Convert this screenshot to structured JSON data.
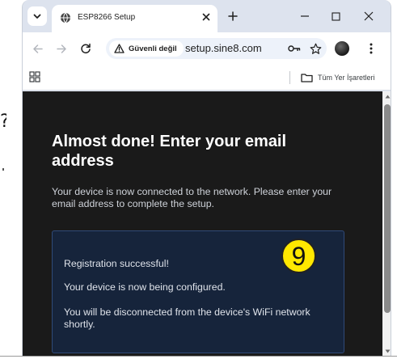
{
  "browser": {
    "tab_title": "ESP8266 Setup",
    "security_label": "Güvenli değil",
    "url": "setup.sine8.com",
    "bookmarks_all_label": "Tüm Yer İşaretleri"
  },
  "icons": {
    "tab_search": "chevron-down-icon",
    "favicon": "globe-icon",
    "tab_close": "close-icon",
    "new_tab": "plus-icon",
    "minimize": "minimize-icon",
    "maximize": "maximize-icon",
    "close": "close-icon",
    "back": "arrow-left-icon",
    "forward": "arrow-right-icon",
    "reload": "reload-icon",
    "security": "warning-triangle-icon",
    "password_key": "key-icon",
    "bookmark_star": "star-icon",
    "profile": "avatar",
    "menu": "kebab-menu-icon",
    "apps": "apps-grid-icon",
    "folder": "folder-icon"
  },
  "page": {
    "heading": "Almost done! Enter your email address",
    "intro": "Your device is now connected to the network. Please enter your email address to complete the setup.",
    "status_lines": [
      "Registration successful!",
      "Your device is now being configured.",
      "You will be disconnected from the device's WiFi network shortly."
    ],
    "step_badge": "9"
  },
  "colors": {
    "page_background": "#1a1a1a",
    "status_box_background": "#16243b",
    "status_box_border": "#2f4a78",
    "badge_yellow": "#ffe800"
  }
}
